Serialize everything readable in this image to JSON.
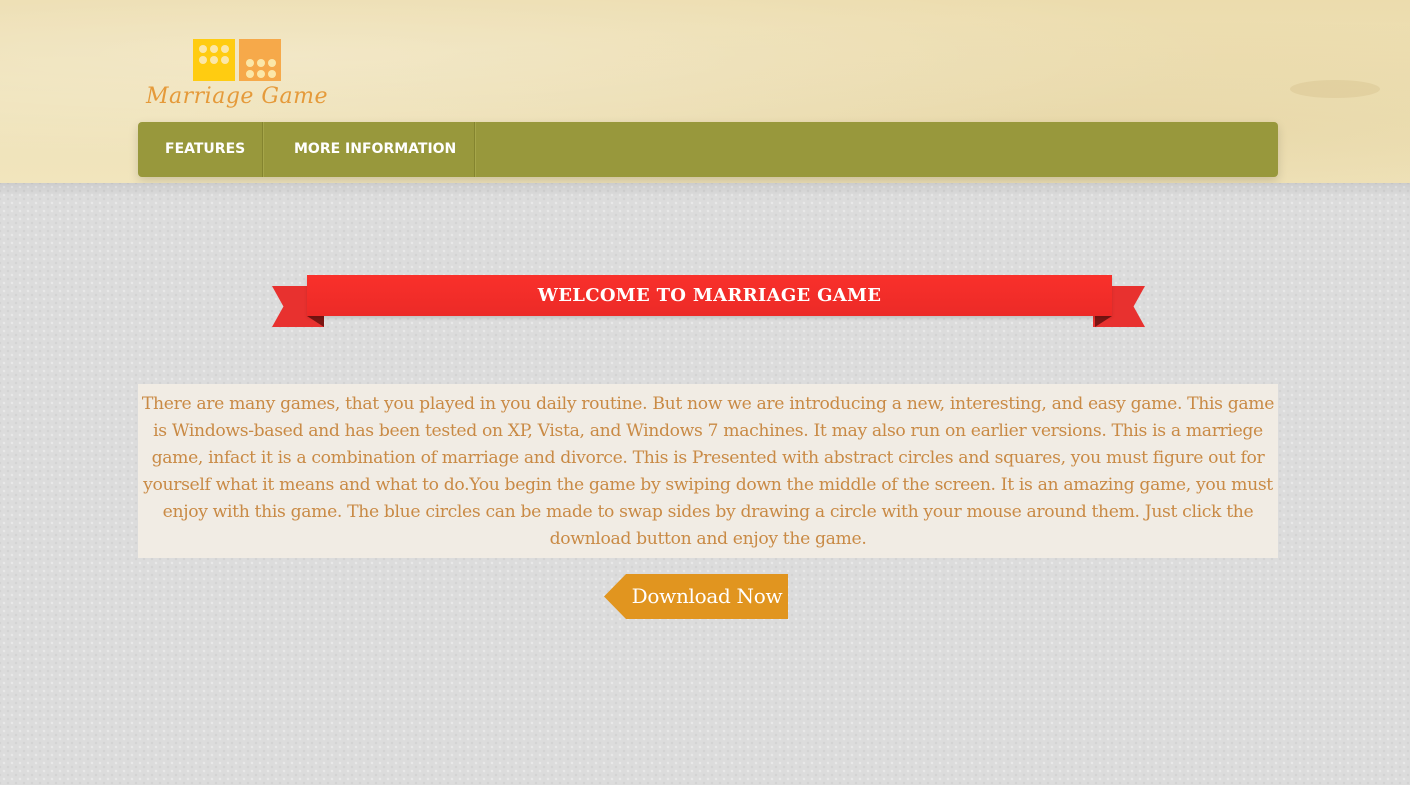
{
  "brand": {
    "name": "Marriage Game",
    "logo_icon": "dice-tiles-icon",
    "colors": {
      "tile_yellow": "#ffcc11",
      "tile_orange": "#f6a94a",
      "text": "#e59a3a"
    }
  },
  "nav": {
    "items": [
      {
        "label": "FEATURES"
      },
      {
        "label": "MORE INFORMATION"
      }
    ],
    "color": "#98983c"
  },
  "banner": {
    "title": "WELCOME TO MARRIAGE GAME",
    "color": "#ec2a27"
  },
  "intro": {
    "text": "There are many games, that you played in you daily routine. But now we are introducing a new, interesting, and easy game. This game is Windows-based and has been tested on XP, Vista, and Windows 7 machines. It may also run on earlier versions. This is a marriege game, infact it is a combination of marriage and divorce. This is Presented with abstract circles and squares, you must figure out for yourself what it means and what to do.You begin the game by swiping down the middle of the screen. It is an amazing game, you must enjoy with this game. The blue circles can be made to swap sides by drawing a circle with your mouse around them. Just click the download button and enjoy the game."
  },
  "download": {
    "label": "Download Now",
    "color": "#e1951f"
  }
}
